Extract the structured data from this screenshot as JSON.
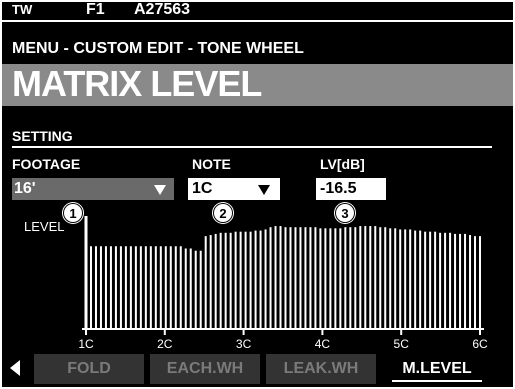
{
  "header": {
    "mode": "TW",
    "favorite": "F1",
    "patch": "A27563",
    "breadcrumb": "MENU - CUSTOM EDIT - TONE WHEEL",
    "title": "MATRIX LEVEL"
  },
  "section": {
    "label": "SETTING"
  },
  "fields": {
    "footage": {
      "label": "FOOTAGE",
      "value": "16'"
    },
    "note": {
      "label": "NOTE",
      "value": "1C"
    },
    "level": {
      "label": "LV[dB]",
      "value": "-16.5"
    }
  },
  "callouts": [
    "1",
    "2",
    "3"
  ],
  "chart_data": {
    "type": "bar",
    "ylabel": "LEVEL",
    "x_tick_labels": [
      "1C",
      "2C",
      "3C",
      "4C",
      "5C",
      "6C"
    ],
    "selected_index": 0,
    "values": [
      1.0,
      0.73,
      0.73,
      0.73,
      0.73,
      0.73,
      0.73,
      0.73,
      0.73,
      0.73,
      0.73,
      0.73,
      0.73,
      0.73,
      0.73,
      0.73,
      0.73,
      0.73,
      0.73,
      0.73,
      0.71,
      0.71,
      0.69,
      0.69,
      0.82,
      0.83,
      0.84,
      0.85,
      0.85,
      0.85,
      0.86,
      0.86,
      0.86,
      0.86,
      0.87,
      0.87,
      0.88,
      0.9,
      0.91,
      0.91,
      0.9,
      0.9,
      0.9,
      0.9,
      0.9,
      0.9,
      0.9,
      0.89,
      0.89,
      0.89,
      0.89,
      0.89,
      0.9,
      0.9,
      0.9,
      0.91,
      0.91,
      0.91,
      0.91,
      0.9,
      0.9,
      0.89,
      0.89,
      0.88,
      0.88,
      0.88,
      0.87,
      0.87,
      0.86,
      0.86,
      0.86,
      0.85,
      0.85,
      0.85,
      0.84,
      0.84,
      0.84,
      0.83,
      0.82,
      0.82
    ]
  },
  "tabs": [
    {
      "label": "FOLD"
    },
    {
      "label": "EACH.WH"
    },
    {
      "label": "LEAK.WH"
    },
    {
      "label": "M.LEVEL"
    }
  ]
}
